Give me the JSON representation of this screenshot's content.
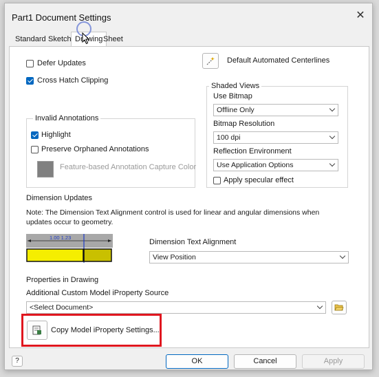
{
  "window": {
    "title": "Part1 Document Settings"
  },
  "tabs": [
    {
      "label": "Standard"
    },
    {
      "label": "Sketch"
    },
    {
      "label": "Drawing"
    },
    {
      "label": "Sheet"
    }
  ],
  "options": {
    "defer_updates": "Defer Updates",
    "cross_hatch_clipping": "Cross Hatch Clipping",
    "default_centerlines": "Default Automated Centerlines"
  },
  "invalid_annotations": {
    "title": "Invalid Annotations",
    "highlight": "Highlight",
    "preserve_orphaned": "Preserve Orphaned Annotations",
    "capture_color": "Feature-based Annotation Capture Color"
  },
  "shaded_views": {
    "title": "Shaded Views",
    "use_bitmap_label": "Use Bitmap",
    "use_bitmap_value": "Offline Only",
    "resolution_label": "Bitmap Resolution",
    "resolution_value": "100 dpi",
    "reflection_label": "Reflection Environment",
    "reflection_value": "Use Application Options",
    "specular": "Apply specular effect"
  },
  "dimension_updates": {
    "title": "Dimension Updates",
    "note": "Note: The Dimension Text Alignment control is used for linear and angular dimensions when updates occur to geometry.",
    "preview_text": "1.00 1.23",
    "alignment_label": "Dimension Text Alignment",
    "alignment_value": "View Position"
  },
  "properties": {
    "title": "Properties in Drawing",
    "source_label": "Additional Custom Model iProperty Source",
    "source_value": "<Select Document>",
    "copy_button": "Copy Model iProperty Settings..."
  },
  "footer": {
    "help": "?",
    "ok": "OK",
    "cancel": "Cancel",
    "apply": "Apply"
  },
  "colors": {
    "accent": "#0067c0",
    "highlight_box": "#e0161e",
    "preview_yellow": "#f5ee00",
    "preview_yellow_dark": "#c9c000"
  }
}
